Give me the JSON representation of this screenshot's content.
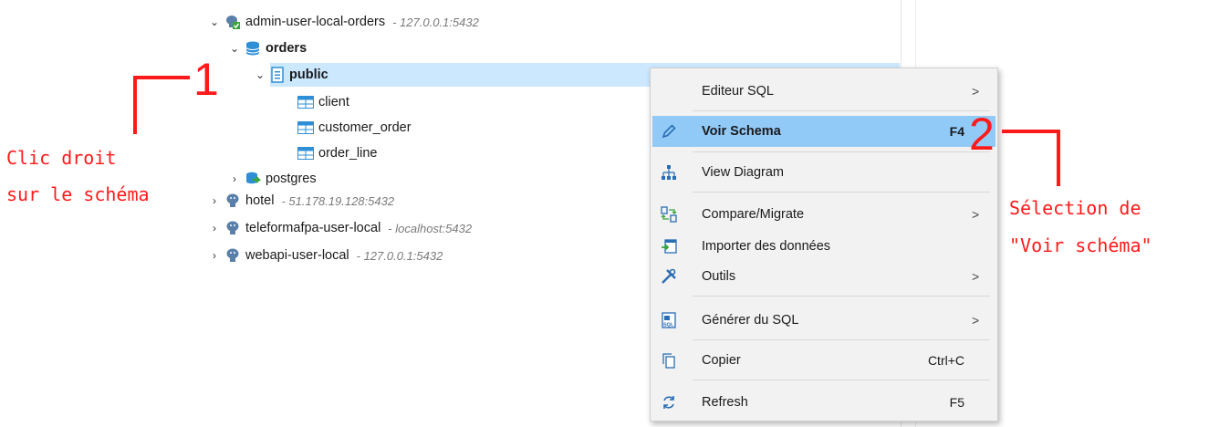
{
  "tree": {
    "connection": {
      "name": "admin-user-local-orders",
      "address": "- 127.0.0.1:5432"
    },
    "database": "orders",
    "schema": "public",
    "tables": [
      "client",
      "customer_order",
      "order_line"
    ],
    "postgres": "postgres",
    "other_connections": [
      {
        "name": "hotel",
        "address": "- 51.178.19.128:5432"
      },
      {
        "name": "teleformafpa-user-local",
        "address": "- localhost:5432"
      },
      {
        "name": "webapi-user-local",
        "address": "- 127.0.0.1:5432"
      }
    ]
  },
  "context_menu": {
    "items": [
      {
        "label": "Editeur SQL",
        "submenu": true,
        "shortcut": "",
        "icon": "none"
      },
      {
        "label": "Voir Schema",
        "submenu": false,
        "shortcut": "F4",
        "icon": "pencil-icon"
      },
      {
        "label": "View Diagram",
        "submenu": false,
        "shortcut": "",
        "icon": "diagram-icon"
      },
      {
        "label": "Compare/Migrate",
        "submenu": true,
        "shortcut": "",
        "icon": "compare-icon"
      },
      {
        "label": "Importer des données",
        "submenu": false,
        "shortcut": "",
        "icon": "import-icon"
      },
      {
        "label": "Outils",
        "submenu": true,
        "shortcut": "",
        "icon": "tools-icon"
      },
      {
        "label": "Générer du SQL",
        "submenu": true,
        "shortcut": "",
        "icon": "sql-icon"
      },
      {
        "label": "Copier",
        "submenu": false,
        "shortcut": "Ctrl+C",
        "icon": "copy-icon"
      },
      {
        "label": "Refresh",
        "submenu": false,
        "shortcut": "F5",
        "icon": "refresh-icon"
      }
    ],
    "arrow_glyph": ">"
  },
  "annotations": {
    "step1_number": "1",
    "step1_text_line1": "Clic droit",
    "step1_text_line2": "sur le schéma",
    "step2_number": "2",
    "step2_text_line1": "Sélection de",
    "step2_text_line2": "\"Voir schéma\""
  },
  "colors": {
    "selection": "#cce8ff",
    "menu_highlight": "#91c9f7",
    "annotation": "#ff1a1a",
    "table_icon": "#2f8fd6"
  }
}
